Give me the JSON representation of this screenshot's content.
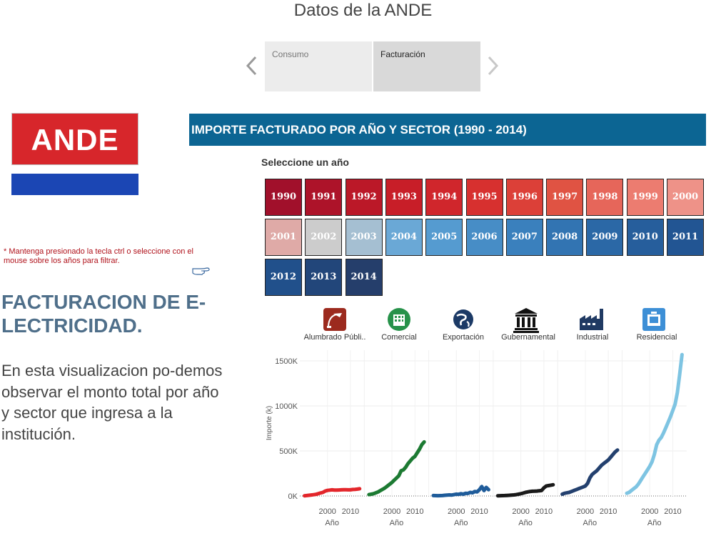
{
  "page_title": "Datos de la ANDE",
  "tabs": [
    {
      "label": "Consumo",
      "active": false
    },
    {
      "label": "Facturación",
      "active": true
    }
  ],
  "logo_text": "ANDE",
  "banner_title": "IMPORTE FACTURADO POR AÑO Y SECTOR (1990 - 2014)",
  "select_label": "Seleccione un año",
  "years": [
    {
      "label": "1990",
      "color": "#a1102b"
    },
    {
      "label": "1991",
      "color": "#ad1329"
    },
    {
      "label": "1992",
      "color": "#bb1828"
    },
    {
      "label": "1993",
      "color": "#c81e28"
    },
    {
      "label": "1994",
      "color": "#d0262c"
    },
    {
      "label": "1995",
      "color": "#d7302f"
    },
    {
      "label": "1996",
      "color": "#dc4038"
    },
    {
      "label": "1997",
      "color": "#e05343"
    },
    {
      "label": "1998",
      "color": "#e6665a"
    },
    {
      "label": "1999",
      "color": "#ec7c70"
    },
    {
      "label": "2000",
      "color": "#ee9288"
    },
    {
      "label": "2001",
      "color": "#dfaaa7"
    },
    {
      "label": "2002",
      "color": "#cccccc"
    },
    {
      "label": "2003",
      "color": "#a5bfd2"
    },
    {
      "label": "2004",
      "color": "#6aa8d6"
    },
    {
      "label": "2005",
      "color": "#559bd0"
    },
    {
      "label": "2006",
      "color": "#478dc6"
    },
    {
      "label": "2007",
      "color": "#3a80bd"
    },
    {
      "label": "2008",
      "color": "#3274b2"
    },
    {
      "label": "2009",
      "color": "#2b68a6"
    },
    {
      "label": "2010",
      "color": "#265e9c"
    },
    {
      "label": "2011",
      "color": "#225593"
    },
    {
      "label": "2012",
      "color": "#21508b"
    },
    {
      "label": "2013",
      "color": "#22467a"
    },
    {
      "label": "2014",
      "color": "#253e6b"
    }
  ],
  "note": "* Mantenga presionado la tecla ctrl o seleccione con el mouse sobre los años para filtrar.",
  "side_title": "FACTURACION DE E-LECTRICIDAD.",
  "side_text": "En esta visualizacion po-demos observar el monto total por año y sector que ingresa a la institución.",
  "icons": {
    "prev": "chevron-left-icon",
    "next": "chevron-right-icon",
    "hand": "pointing-hand-icon"
  },
  "chart_data": {
    "type": "line",
    "ylabel": "Importe (k)",
    "xlabel": "Año",
    "y_ticks": [
      "0K",
      "500K",
      "1000K",
      "1500K"
    ],
    "x_ticks": [
      "2000",
      "2010"
    ],
    "ylim": [
      0,
      1600000
    ],
    "xlim": [
      1988,
      2016
    ],
    "x": [
      1990,
      1991,
      1992,
      1993,
      1994,
      1995,
      1996,
      1997,
      1998,
      1999,
      2000,
      2001,
      2002,
      2003,
      2004,
      2005,
      2006,
      2007,
      2008,
      2009,
      2010,
      2011,
      2012,
      2013,
      2014
    ],
    "series": [
      {
        "name": "Alumbrado Públi..",
        "icon": "street-light-icon",
        "color": "#e3262b",
        "values": [
          2000,
          5000,
          8000,
          11000,
          14000,
          18000,
          25000,
          33000,
          40000,
          55000,
          62000,
          65000,
          68000,
          66000,
          65000,
          67000,
          68000,
          70000,
          69000,
          68000,
          68000,
          72000,
          74000,
          76000,
          80000
        ]
      },
      {
        "name": "Comercial",
        "icon": "building-icon",
        "color": "#1c7a32",
        "values": [
          15000,
          20000,
          25000,
          35000,
          45000,
          60000,
          75000,
          90000,
          110000,
          130000,
          150000,
          175000,
          200000,
          225000,
          280000,
          290000,
          320000,
          360000,
          390000,
          420000,
          440000,
          480000,
          520000,
          570000,
          600000
        ]
      },
      {
        "name": "Exportación",
        "icon": "globe-icon",
        "color": "#1f5c9a",
        "values": [
          5000,
          4000,
          3000,
          4000,
          5000,
          8000,
          10000,
          12000,
          10000,
          15000,
          20000,
          18000,
          25000,
          20000,
          30000,
          28000,
          40000,
          35000,
          50000,
          45000,
          70000,
          105000,
          60000,
          95000,
          70000
        ]
      },
      {
        "name": "Gubernamental",
        "icon": "government-building-icon",
        "color": "#1a1a1a",
        "values": [
          2000,
          3000,
          4000,
          5000,
          6000,
          8000,
          10000,
          12000,
          15000,
          20000,
          25000,
          32000,
          40000,
          45000,
          50000,
          52000,
          53000,
          55000,
          58000,
          60000,
          90000,
          110000,
          115000,
          120000,
          125000
        ]
      },
      {
        "name": "Industrial",
        "icon": "factory-icon",
        "color": "#23406e",
        "values": [
          20000,
          30000,
          35000,
          40000,
          50000,
          60000,
          70000,
          80000,
          90000,
          100000,
          110000,
          140000,
          200000,
          240000,
          260000,
          280000,
          310000,
          340000,
          360000,
          380000,
          400000,
          430000,
          460000,
          490000,
          510000
        ]
      },
      {
        "name": "Residencial",
        "icon": "house-icon",
        "color": "#7ec4e2",
        "values": [
          30000,
          40000,
          60000,
          80000,
          100000,
          130000,
          170000,
          210000,
          250000,
          290000,
          330000,
          380000,
          460000,
          570000,
          620000,
          650000,
          700000,
          760000,
          820000,
          880000,
          950000,
          1020000,
          1150000,
          1350000,
          1570000
        ]
      }
    ]
  }
}
